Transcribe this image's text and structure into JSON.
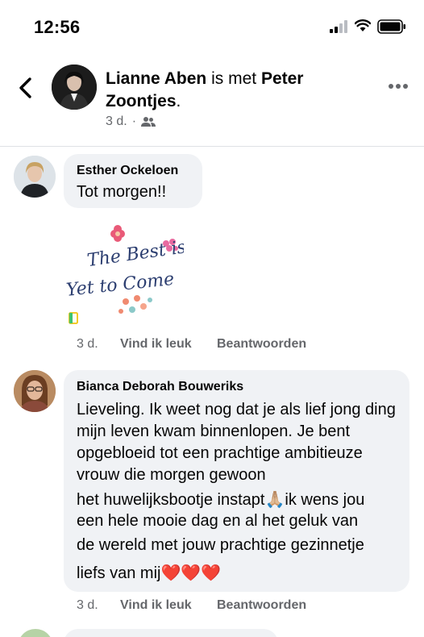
{
  "status_bar": {
    "time": "12:56"
  },
  "header": {
    "author": "Lianne Aben",
    "with_text": "is met",
    "tagged": "Peter Zoontjes",
    "period": ".",
    "time": "3 d.",
    "separator": "·",
    "audience_icon": "friends-icon"
  },
  "comments": [
    {
      "name": "Esther Ockeloen",
      "text": "Tot morgen!!",
      "sticker_text_1": "The Best is",
      "sticker_text_2": "Yet to Come",
      "time": "3 d.",
      "like": "Vind ik leuk",
      "reply": "Beantwoorden"
    },
    {
      "name": "Bianca Deborah Bouweriks",
      "text_block": "Lieveling. Ik weet nog dat je als lief jong ding mijn leven kwam binnenlopen. Je bent opgebloeid tot een prachtige ambitieuze vrouw die morgen gewoon",
      "line5_text": "het huwelijksbootje instapt",
      "line5_emoji": "🙏🏼",
      "line6": "ik wens jou",
      "line6_full": "een hele mooie dag en al het geluk van",
      "line7": "de wereld met jouw prachtige gezinnetje",
      "line8": "liefs van mij",
      "hearts": "❤️❤️❤️",
      "time": "3 d.",
      "like": "Vind ik leuk",
      "reply": "Beantwoorden"
    }
  ],
  "colors": {
    "accent_text": "#050505",
    "secondary_text": "#65676b",
    "bubble_bg": "#f0f2f5",
    "heart": "#e41e3f"
  }
}
